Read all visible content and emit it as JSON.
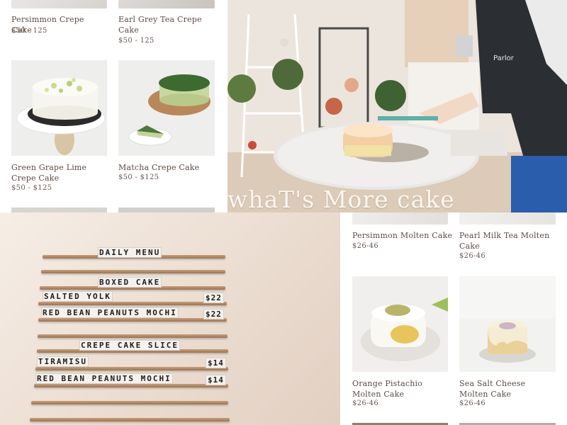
{
  "top_left": {
    "products": [
      {
        "name": "Persimmon Crepe Cake",
        "price": "$50 - 125"
      },
      {
        "name": "Earl Grey Tea Crepe Cake",
        "price": "$50 - 125"
      },
      {
        "name": "Green Grape Lime Crepe Cake",
        "price": "$50 - $125"
      },
      {
        "name": "Matcha Crepe Cake",
        "price": "$50 - $125"
      }
    ]
  },
  "top_right": {
    "headline": "whaT's More cake"
  },
  "menu_board": {
    "title": "DAILY MENU",
    "section1": "BOXED CAKE",
    "item1": "SALTED YOLK",
    "item1_price": "$22",
    "item2": "RED BEAN PEANUTS MOCHI",
    "item2_price": "$22",
    "section2": "CREPE CAKE SLICE",
    "item3": "TIRAMISU",
    "item3_price": "$14",
    "item4": "RED BEAN PEANUTS MOCHI",
    "item4_price": "$14"
  },
  "bottom_right": {
    "products": [
      {
        "name": "Persimmon Molten Cake",
        "price": "$26-46"
      },
      {
        "name": "Pearl Milk Tea Molten Cake",
        "price": "$26-46"
      },
      {
        "name": "Orange Pistachio Molten Cake",
        "price": "$26-46"
      },
      {
        "name": "Sea Salt Cheese Molten Cake",
        "price": "$26-46"
      }
    ]
  }
}
